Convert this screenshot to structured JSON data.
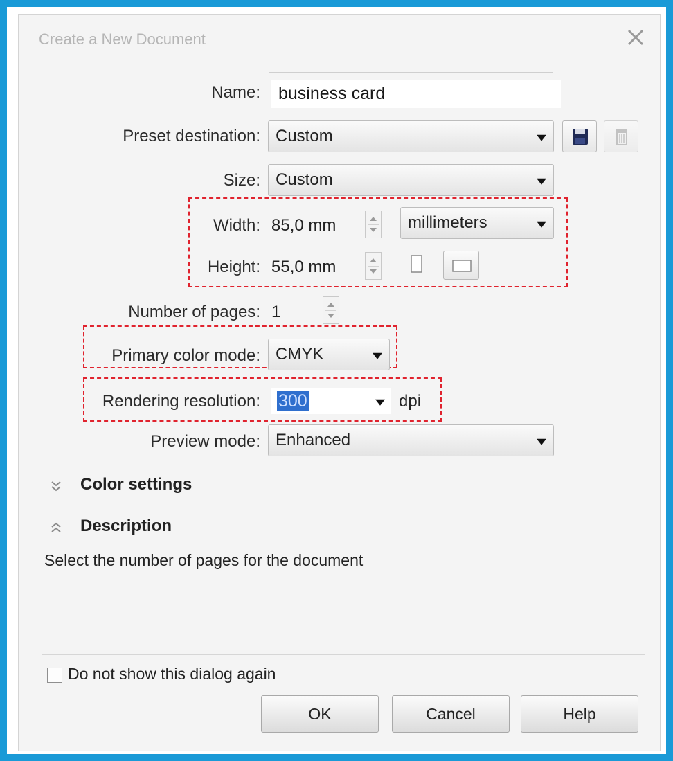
{
  "dialog": {
    "title": "Create a New Document",
    "close_icon": "close-icon"
  },
  "form": {
    "name_label": "Name:",
    "name_value": "business card",
    "preset_label": "Preset destination:",
    "preset_value": "Custom",
    "save_icon": "floppy-disk-icon",
    "delete_icon": "trash-icon",
    "size_label": "Size:",
    "size_value": "Custom",
    "width_label": "Width:",
    "width_value": "85,0 mm",
    "units_value": "millimeters",
    "height_label": "Height:",
    "height_value": "55,0 mm",
    "portrait_icon": "portrait-orientation-icon",
    "landscape_icon": "landscape-orientation-icon",
    "pages_label": "Number of pages:",
    "pages_value": "1",
    "color_mode_label": "Primary color mode:",
    "color_mode_value": "CMYK",
    "resolution_label": "Rendering resolution:",
    "resolution_value": "300",
    "resolution_unit": "dpi",
    "preview_label": "Preview mode:",
    "preview_value": "Enhanced"
  },
  "sections": {
    "color_settings": "Color settings",
    "color_settings_icon": "expand-chevrons-icon",
    "description": "Description",
    "description_icon": "collapse-chevrons-icon",
    "description_text": "Select the number of pages for the document"
  },
  "footer": {
    "checkbox_label": "Do not show this dialog again",
    "ok": "OK",
    "cancel": "Cancel",
    "help": "Help"
  },
  "colors": {
    "frame": "#1a9ad7",
    "highlight_dash": "#e0232e",
    "selection": "#2f6fce"
  }
}
